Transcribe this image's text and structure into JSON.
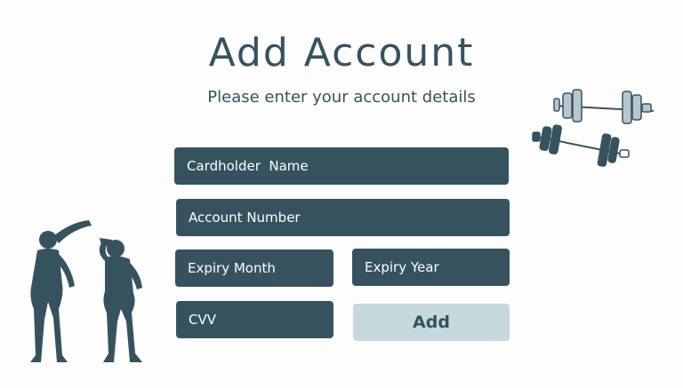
{
  "header": {
    "title": "Add Account",
    "subtitle": "Please enter your account details"
  },
  "form": {
    "cardholder_name_placeholder": "Cardholder  Name",
    "account_number_placeholder": "Account Number",
    "expiry_month_placeholder": "Expiry Month",
    "expiry_year_placeholder": "Expiry Year",
    "cvv_placeholder": "CVV",
    "add_label": "Add"
  },
  "icons": {
    "dumbbells": "dumbbells-icon",
    "athletes": "athletes-silhouette-icon"
  },
  "colors": {
    "primary": "#36525f",
    "button_light": "#c7d8df",
    "dumbbell_light": "#b7c7cf",
    "background": "#fdfdfd"
  }
}
